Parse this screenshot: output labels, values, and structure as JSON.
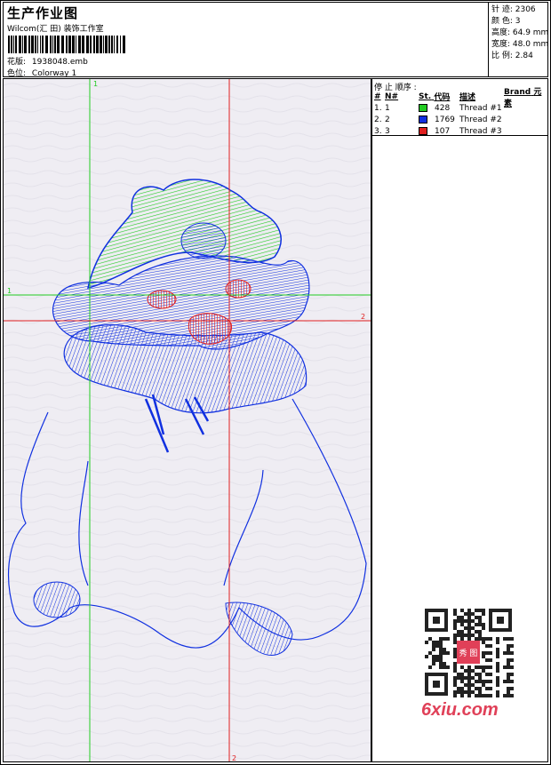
{
  "header": {
    "title": "生产作业图",
    "company": "Wilcom(汇 ⽥) 装饰⼯作室",
    "design_label": "花版:",
    "design_value": "1938048.emb",
    "colorway_label": "色位:",
    "colorway_value": "Colorway 1"
  },
  "stats": {
    "stitches": "针 迹: 2306",
    "colors": "颜 色: 3",
    "height": "高度: 64.9 mm",
    "width": "宽度: 48.0 mm",
    "scale": "比 例: 2.84"
  },
  "stop_sequence": {
    "title": "停 止 顺序 :",
    "columns": [
      "#",
      "N#",
      "St.",
      "代码",
      "描述",
      "Brand",
      "元素"
    ],
    "rows": [
      {
        "index": "1.",
        "n": "1",
        "stitches": "428",
        "color": "#22cc22",
        "desc": "Thread #1"
      },
      {
        "index": "2.",
        "n": "2",
        "stitches": "1769",
        "color": "#1030e0",
        "desc": "Thread #2"
      },
      {
        "index": "3.",
        "n": "3",
        "stitches": "107",
        "color": "#e02020",
        "desc": "Thread #3"
      }
    ]
  },
  "guides": {
    "green_label_top": "1",
    "green_label_left": "1",
    "red_label_right": "2",
    "red_label_bottom": "2"
  },
  "watermark": {
    "text": "6xiu.com",
    "qr_label": "秀 图"
  },
  "colors": {
    "green": "#22cc22",
    "blue": "#1030e0",
    "red": "#e02020",
    "canvas_bg": "#efedf3"
  }
}
